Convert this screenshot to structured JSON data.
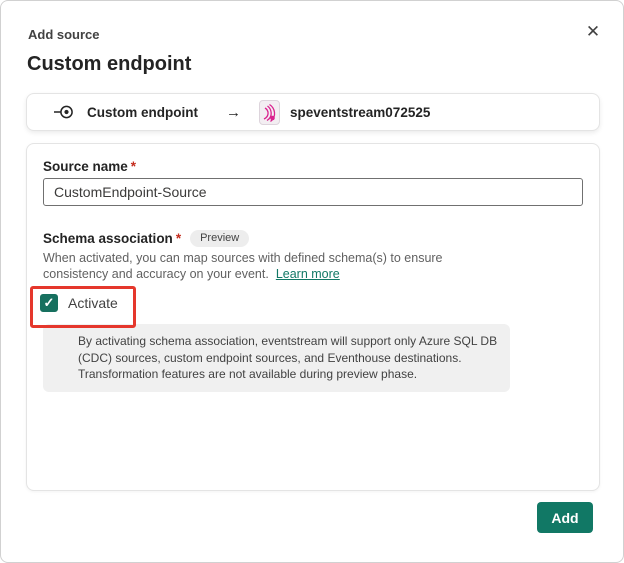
{
  "dialog": {
    "eyebrow": "Add source",
    "title": "Custom endpoint"
  },
  "icons": {
    "close": "✕",
    "arrow_right": "→",
    "checkmark": "✓"
  },
  "breadcrumb": {
    "source_label": "Custom endpoint",
    "target_label": "speventstream072525"
  },
  "form": {
    "source_name": {
      "label": "Source name",
      "required_mark": "*",
      "value": "CustomEndpoint-Source"
    },
    "schema_association": {
      "label": "Schema association",
      "required_mark": "*",
      "badge": "Preview",
      "description": "When activated, you can map sources with defined schema(s) to ensure consistency and accuracy on your event.",
      "learn_more": "Learn more",
      "checkbox_label": "Activate",
      "checkbox_checked": true,
      "info_note": "By activating schema association, eventstream will support only Azure SQL DB (CDC) sources, custom endpoint sources, and Eventhouse destinations. Transformation features are not available during preview phase."
    }
  },
  "footer": {
    "add_label": "Add"
  },
  "colors": {
    "accent_teal": "#117865",
    "checkbox_teal": "#17705f",
    "annotation_red": "#e5372c",
    "asterisk_red": "#c42b1c",
    "eventstream_pink": "#d9218e",
    "link_green": "#117865"
  }
}
